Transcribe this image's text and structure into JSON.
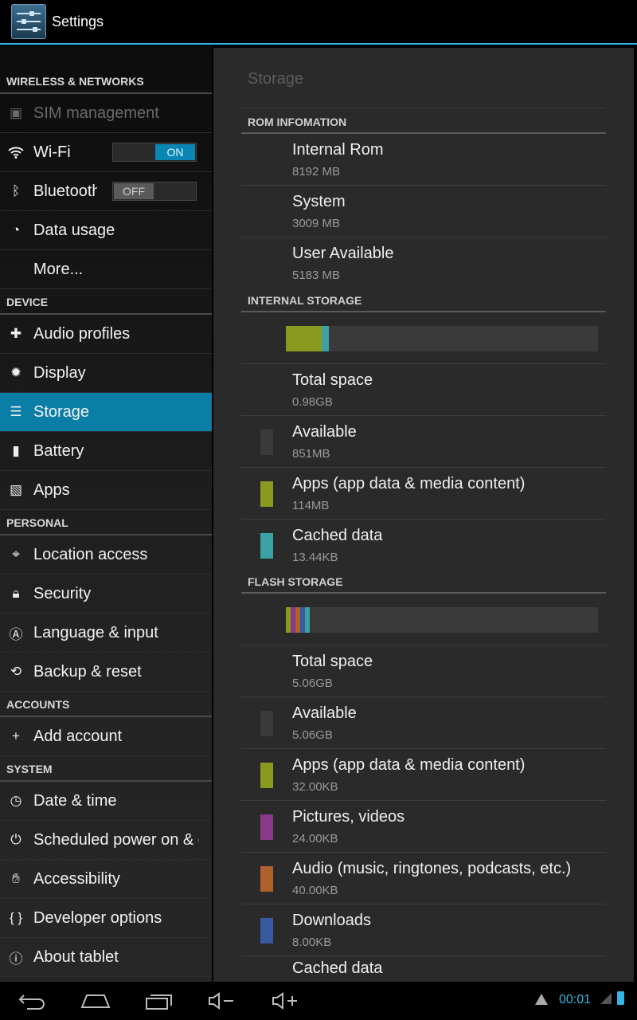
{
  "app": {
    "title": "Settings"
  },
  "left_pane": {
    "categories": {
      "wireless": "WIRELESS & NETWORKS",
      "device": "DEVICE",
      "personal": "PERSONAL",
      "accounts": "ACCOUNTS",
      "system": "SYSTEM"
    },
    "items": {
      "sim": "SIM management",
      "wifi": "Wi-Fi",
      "bluetooth": "Bluetooth",
      "data_usage": "Data usage",
      "more": "More...",
      "audio_profiles": "Audio profiles",
      "display": "Display",
      "storage": "Storage",
      "battery": "Battery",
      "apps": "Apps",
      "location": "Location access",
      "security": "Security",
      "language": "Language & input",
      "backup": "Backup & reset",
      "add_account": "Add account",
      "date_time": "Date & time",
      "scheduled_power": "Scheduled power on & off",
      "accessibility": "Accessibility",
      "developer": "Developer options",
      "about": "About tablet"
    },
    "toggles": {
      "wifi": "ON",
      "bluetooth": "OFF"
    },
    "selected": "Storage"
  },
  "right_pane": {
    "title": "Storage",
    "rom": {
      "header": "ROM INFOMATION",
      "rows": [
        {
          "title": "Internal Rom",
          "value": "8192 MB"
        },
        {
          "title": "System",
          "value": "3009 MB"
        },
        {
          "title": "User Available",
          "value": "5183 MB"
        }
      ]
    },
    "internal": {
      "header": "INTERNAL STORAGE",
      "bar_fractions": {
        "apps": 0.115,
        "cached": 0.013
      },
      "rows": [
        {
          "title": "Total space",
          "value": "0.98GB"
        },
        {
          "title": "Available",
          "value": "851MB",
          "color": "#3a3a3a"
        },
        {
          "title": "Apps (app data & media content)",
          "value": "114MB",
          "color": "#8a9a1f"
        },
        {
          "title": "Cached data",
          "value": "13.44KB",
          "color": "#3ba3a3"
        }
      ]
    },
    "flash": {
      "header": "FLASH STORAGE",
      "bar_segment_colors": [
        "#8a9a1f",
        "#8a3a8a",
        "#b0602a",
        "#3a5aa0",
        "#3ba3a3"
      ],
      "rows": [
        {
          "title": "Total space",
          "value": "5.06GB"
        },
        {
          "title": "Available",
          "value": "5.06GB",
          "color": "#3a3a3a"
        },
        {
          "title": "Apps (app data & media content)",
          "value": "32.00KB",
          "color": "#8a9a1f"
        },
        {
          "title": "Pictures, videos",
          "value": "24.00KB",
          "color": "#8a3a8a"
        },
        {
          "title": "Audio (music, ringtones, podcasts, etc.)",
          "value": "40.00KB",
          "color": "#b0602a"
        },
        {
          "title": "Downloads",
          "value": "8.00KB",
          "color": "#3a5aa0"
        },
        {
          "title": "Cached data",
          "value": ""
        }
      ]
    }
  },
  "status_bar": {
    "time": "00:01"
  }
}
